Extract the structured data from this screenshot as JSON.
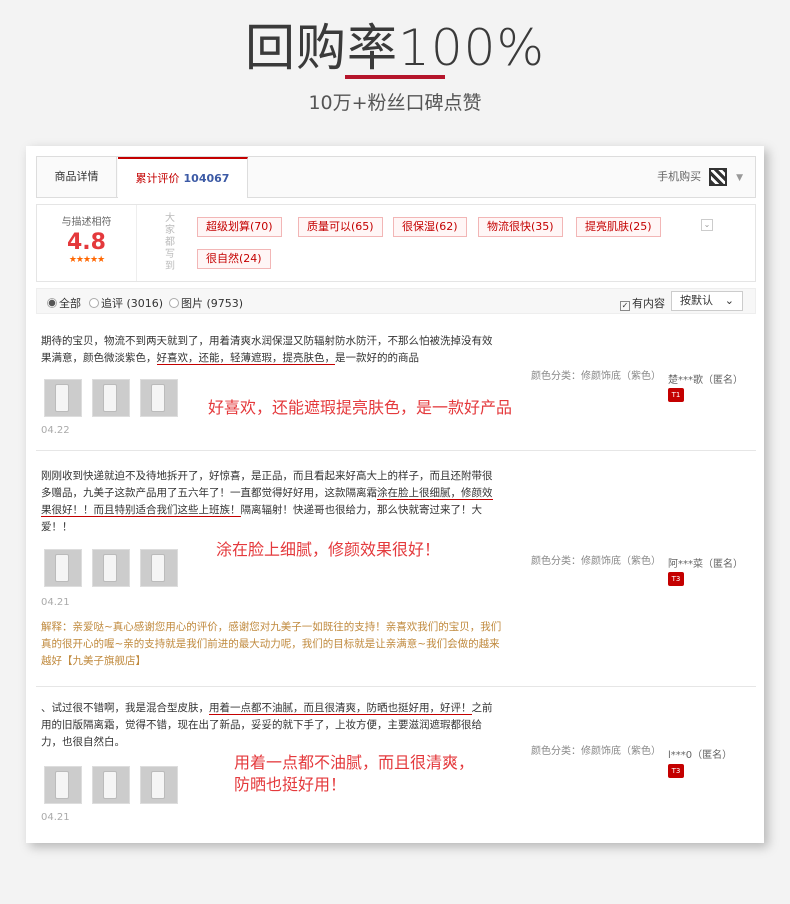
{
  "hero": {
    "title": "回购率100%",
    "subtitle": "10万+粉丝口碑点赞"
  },
  "tabs": {
    "detail": "商品详情",
    "reviews_label": "累计评价",
    "reviews_count": "104067",
    "mobile_buy": "手机购买"
  },
  "summary": {
    "score_label": "与描述相符",
    "score": "4.8",
    "stars": "★★★★★",
    "vertical_label": "大家都写到",
    "tags": [
      "超级划算(70)",
      "质量可以(65)",
      "很保湿(62)",
      "物流很快(35)",
      "提亮肌肤(25)",
      "很自然(24)"
    ]
  },
  "filter": {
    "all": "全部",
    "followup": "追评 (3016)",
    "images": "图片 (9753)",
    "has_content": "有内容",
    "sort": "按默认"
  },
  "reviews": [
    {
      "text_a": "期待的宝贝，物流不到两天就到了，用着清爽水润保湿又防辐射防水防汗，不那么怕被洗掉没有效果满意，颜色微淡紫色，",
      "text_ul": "好喜欢，还能，轻薄遮瑕，提亮肤色，",
      "text_b": "是一款好的的商品",
      "highlight": "好喜欢，还能遮瑕提亮肤色，是一款好产品",
      "date": "04.22",
      "variant": "颜色分类：修颜饰底（紫色）",
      "author": "楚***歌（匿名）",
      "badge": "T1"
    },
    {
      "text_a": "刚刚收到快递就迫不及待地拆开了，好惊喜，是正品，而且看起来好高大上的样子，而且还附带很多赠品，九美子这款产品用了五六年了！一直都觉得好好用，这款隔离霜",
      "text_ul": "涂在脸上很细腻，修颜效果很好！！而且特别适合我们这些上班族！",
      "text_b": "隔离辐射！快递哥也很给力，那么快就寄过来了！大爱！！",
      "highlight": "涂在脸上细腻，修颜效果很好！",
      "date": "04.21",
      "reply": "解释：亲爱哒~真心感谢您用心的评价，感谢您对九美子一如既往的支持！亲喜欢我们的宝贝，我们真的很开心的喔~亲的支持就是我们前进的最大动力呢，我们的目标就是让亲满意~我们会做的越来越好【九美子旗舰店】",
      "variant": "颜色分类：修颜饰底（紫色）",
      "author": "阿***菜（匿名）",
      "badge": "T3"
    },
    {
      "text_a": "、试过很不错啊，我是混合型皮肤，",
      "text_ul": "用着一点都不油腻，而且很清爽，防晒也挺好用，好评！",
      "text_b": "之前用的旧版隔离霜，觉得不错，现在出了新品，妥妥的就下手了，上妆方便，主要滋润遮瑕都很给力，也很自然白。",
      "highlight": "用着一点都不油腻，而且很清爽，\n防晒也挺好用！",
      "date": "04.21",
      "variant": "颜色分类：修颜饰底（紫色）",
      "author": "l***0（匿名）",
      "badge": "T3"
    }
  ],
  "colors": {
    "accent": "#c40000",
    "hero_line": "#b5152b",
    "highlight": "#e4393c",
    "reply": "#c08a3e"
  }
}
